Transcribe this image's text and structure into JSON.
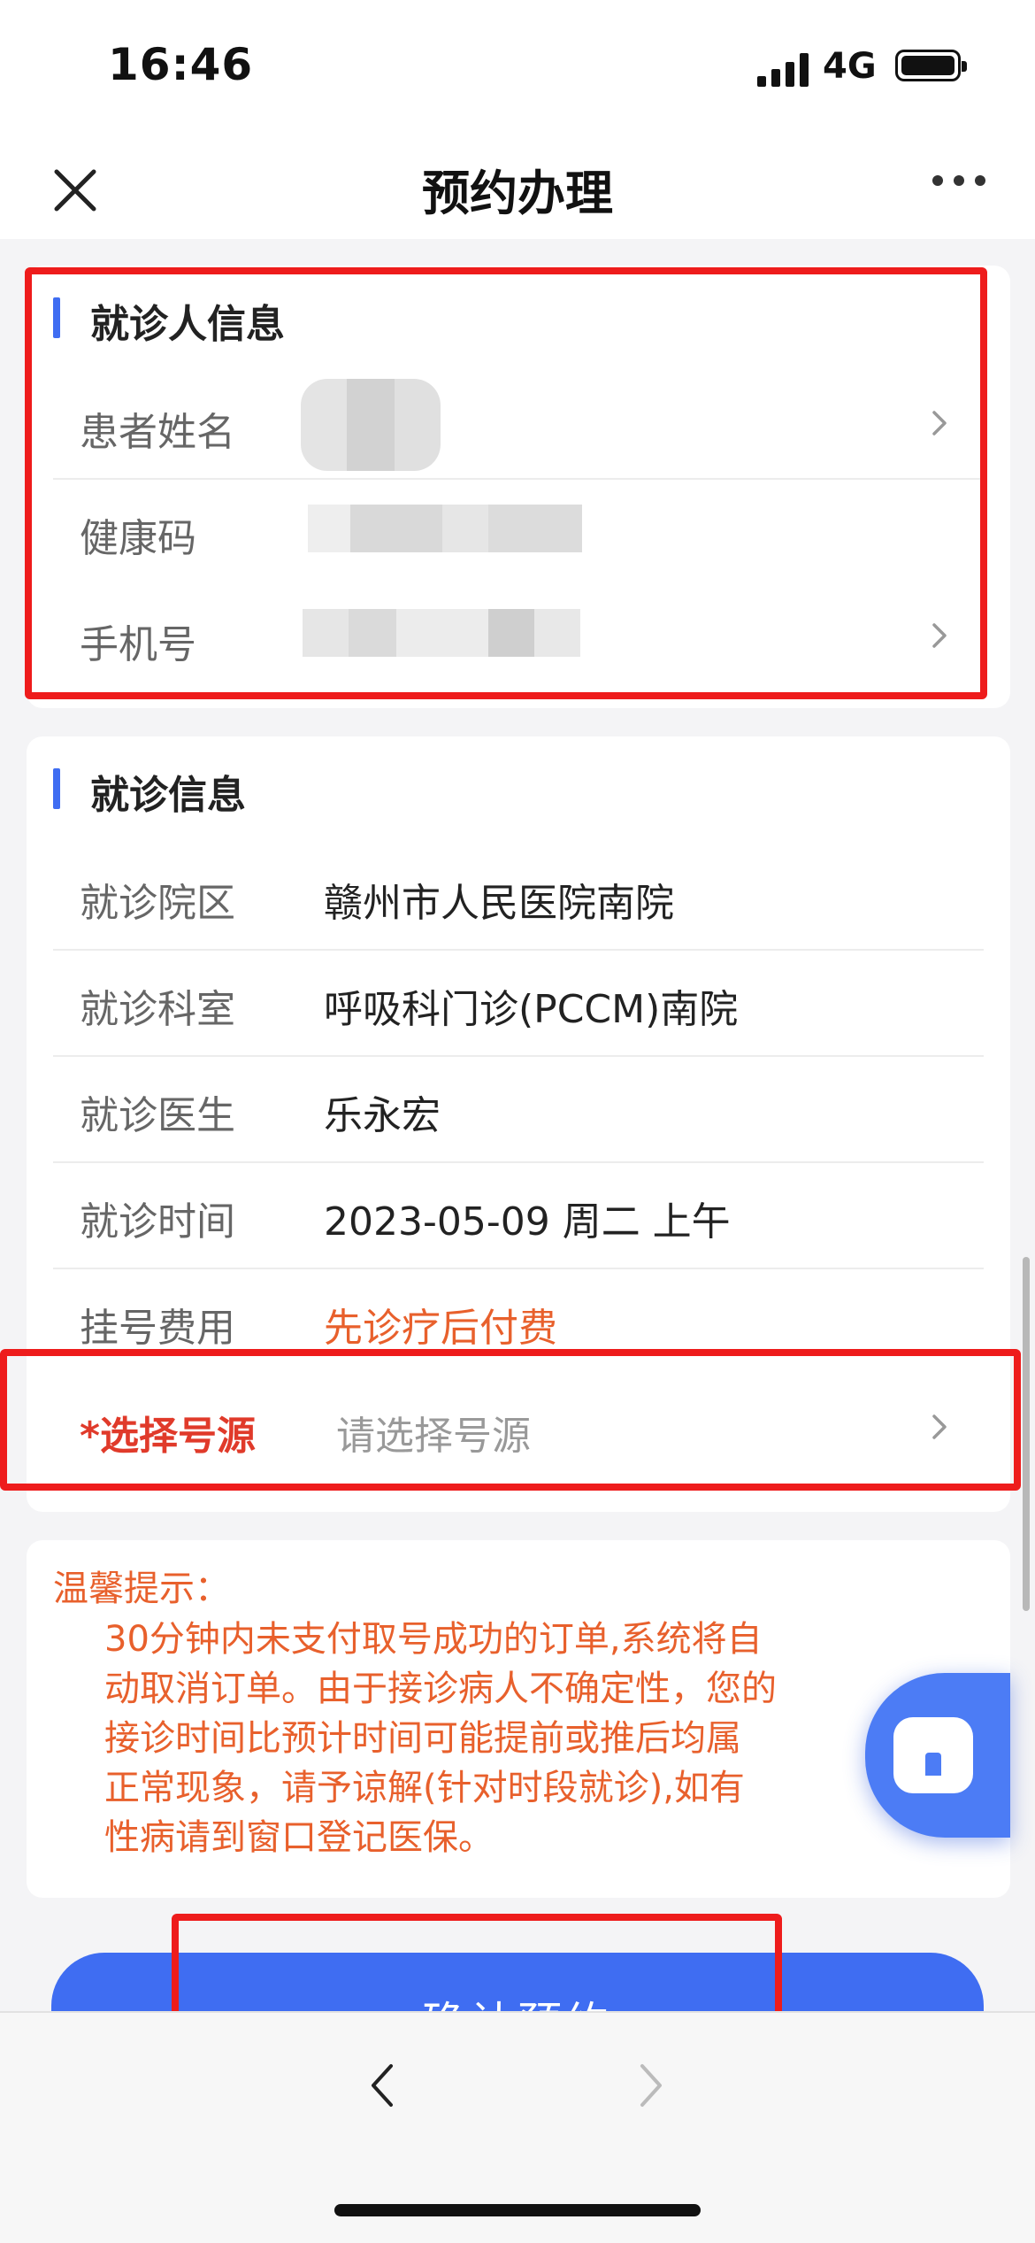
{
  "status_bar": {
    "time": "16:46",
    "network": "4G"
  },
  "nav": {
    "title": "预约办理"
  },
  "patient": {
    "section_title": "就诊人信息",
    "name_label": "患者姓名",
    "health_code_label": "健康码",
    "phone_label": "手机号"
  },
  "visit": {
    "section_title": "就诊信息",
    "rows": [
      {
        "label": "就诊院区",
        "value": "赣州市人民医院南院"
      },
      {
        "label": "就诊科室",
        "value": "呼吸科门诊(PCCM)南院"
      },
      {
        "label": "就诊医生",
        "value": "乐永宏"
      },
      {
        "label": "就诊时间",
        "value": "2023-05-09 周二 上午"
      },
      {
        "label": "挂号费用",
        "value": "先诊疗后付费"
      }
    ],
    "source_label": "*选择号源",
    "source_placeholder": "请选择号源"
  },
  "notice": {
    "title": "温馨提示：",
    "lines": [
      "30分钟内未支付取号成功的订单,系统将自",
      "动取消订单。由于接诊病人不确定性，您的",
      "接诊时间比预计时间可能提前或推后均属",
      "正常现象，请予谅解(针对时段就诊),如有",
      "性病请到窗口登记医保。"
    ]
  },
  "confirm_button": "确认预约",
  "colors": {
    "accent": "#3f6df2",
    "warning": "#e8602c",
    "required": "#e03a2a",
    "highlight_box": "#ee1c1c"
  }
}
